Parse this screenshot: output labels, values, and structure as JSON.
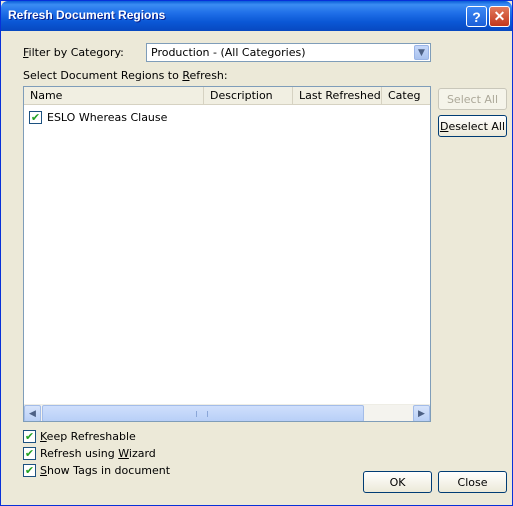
{
  "window": {
    "title": "Refresh Document Regions",
    "help_glyph": "?",
    "close_glyph": "✕"
  },
  "filter": {
    "label_pre": "",
    "label_accel": "F",
    "label_post": "ilter by Category:",
    "selected": "Production - (All Categories)"
  },
  "list_label": {
    "pre": "Select Document Regions to ",
    "accel": "R",
    "post": "efresh:"
  },
  "columns": [
    "Name",
    "Description",
    "Last Refreshed",
    "Categ"
  ],
  "rows": [
    {
      "checked": true,
      "name": "ESLO Whereas Clause"
    }
  ],
  "buttons": {
    "select_all": "Select All",
    "deselect_pre": "",
    "deselect_accel": "D",
    "deselect_post": "eselect All",
    "ok": "OK",
    "close": "Close"
  },
  "options": {
    "keep": {
      "pre": "",
      "accel": "K",
      "post": "eep Refreshable",
      "checked": true
    },
    "wizard": {
      "pre": "Refresh using ",
      "accel": "W",
      "post": "izard",
      "checked": true
    },
    "tags": {
      "pre": "",
      "accel": "S",
      "post": "how Tags in document",
      "checked": true
    }
  },
  "icons": {
    "check": "✔",
    "arrow_down": "▼",
    "arrow_left": "◀",
    "arrow_right": "▶"
  }
}
